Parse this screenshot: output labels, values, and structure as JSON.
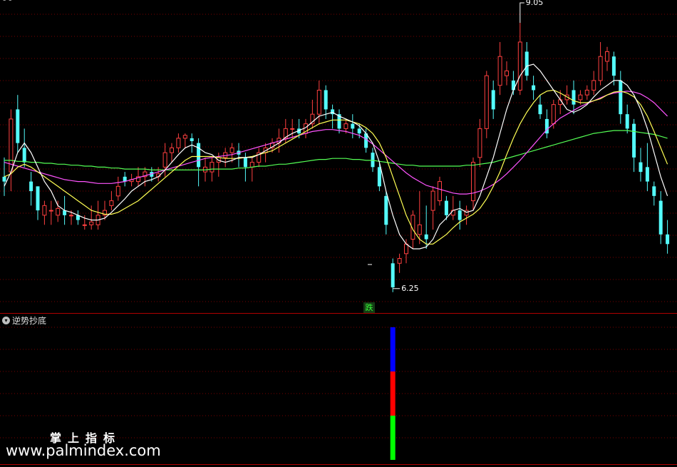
{
  "panels": {
    "indicator_title": "逆势抄底",
    "indicator_icon": "chevron-down-icon",
    "signal_label": "跌",
    "max_label": "9.05",
    "min_label": "6.25",
    "top_title": "- -"
  },
  "watermark": {
    "cn": "掌上指标",
    "url": "www.palmindex.com"
  },
  "colors": {
    "background": "#000000",
    "up_candle": "#ff4040",
    "down_candle": "#54fcfc",
    "ma_fast": "#ffffff",
    "ma_mid": "#ffff54",
    "ma_slow": "#ff54ff",
    "ma_long": "#54ff54",
    "grid": "#7a0000",
    "divider": "#b00000",
    "signal_blue": "#0000ff",
    "signal_red": "#ff0000",
    "signal_green": "#00ff00"
  },
  "chart_data": [
    {
      "type": "candlestick",
      "ylim": [
        6.1,
        9.25
      ],
      "grid": true,
      "series_order": [
        "open",
        "close",
        "high",
        "low"
      ],
      "candles": [
        [
          7.45,
          7.4,
          7.65,
          7.25
        ],
        [
          7.5,
          8.05,
          8.15,
          7.3
        ],
        [
          8.15,
          7.8,
          8.3,
          7.7
        ],
        [
          7.75,
          7.6,
          7.95,
          7.55
        ],
        [
          7.4,
          7.3,
          7.5,
          7.15
        ],
        [
          7.35,
          7.1,
          7.35,
          7.0
        ],
        [
          7.05,
          7.15,
          7.2,
          6.95
        ],
        [
          7.1,
          7.1,
          7.2,
          6.95
        ],
        [
          7.05,
          7.12,
          7.2,
          6.98
        ],
        [
          7.1,
          7.05,
          7.25,
          6.95
        ],
        [
          7.05,
          7.05,
          7.1,
          6.95
        ],
        [
          7.05,
          7.0,
          7.1,
          6.95
        ],
        [
          6.95,
          6.95,
          7.05,
          6.9
        ],
        [
          6.95,
          6.98,
          7.15,
          6.9
        ],
        [
          6.95,
          7.05,
          7.2,
          6.9
        ],
        [
          7.05,
          7.1,
          7.2,
          7.0
        ],
        [
          7.15,
          7.2,
          7.3,
          7.1
        ],
        [
          7.25,
          7.35,
          7.45,
          7.2
        ],
        [
          7.45,
          7.4,
          7.5,
          7.35
        ],
        [
          7.4,
          7.42,
          7.48,
          7.35
        ],
        [
          7.4,
          7.45,
          7.55,
          7.35
        ],
        [
          7.45,
          7.5,
          7.55,
          7.35
        ],
        [
          7.5,
          7.45,
          7.55,
          7.4
        ],
        [
          7.45,
          7.48,
          7.55,
          7.4
        ],
        [
          7.55,
          7.7,
          7.8,
          7.45
        ],
        [
          7.7,
          7.75,
          7.8,
          7.6
        ],
        [
          7.75,
          7.85,
          7.9,
          7.7
        ],
        [
          7.85,
          7.88,
          7.9,
          7.75
        ],
        [
          7.85,
          7.82,
          7.9,
          7.7
        ],
        [
          7.8,
          7.55,
          7.85,
          7.35
        ],
        [
          7.5,
          7.55,
          7.65,
          7.4
        ],
        [
          7.5,
          7.6,
          7.65,
          7.4
        ],
        [
          7.6,
          7.65,
          7.7,
          7.45
        ],
        [
          7.65,
          7.7,
          7.75,
          7.55
        ],
        [
          7.7,
          7.75,
          7.8,
          7.6
        ],
        [
          7.72,
          7.68,
          7.8,
          7.55
        ],
        [
          7.65,
          7.55,
          7.7,
          7.4
        ],
        [
          7.55,
          7.6,
          7.65,
          7.4
        ],
        [
          7.6,
          7.7,
          7.75,
          7.55
        ],
        [
          7.7,
          7.75,
          7.8,
          7.6
        ],
        [
          7.75,
          7.8,
          7.85,
          7.7
        ],
        [
          7.8,
          7.85,
          7.95,
          7.7
        ],
        [
          7.85,
          7.95,
          8.05,
          7.8
        ],
        [
          7.95,
          7.95,
          8.05,
          7.85
        ],
        [
          7.95,
          7.9,
          8.05,
          7.85
        ],
        [
          7.9,
          8.0,
          8.05,
          7.85
        ],
        [
          8.0,
          8.1,
          8.25,
          7.95
        ],
        [
          8.1,
          8.35,
          8.45,
          8.0
        ],
        [
          8.35,
          8.15,
          8.4,
          8.05
        ],
        [
          8.15,
          8.1,
          8.2,
          7.95
        ],
        [
          8.1,
          7.95,
          8.15,
          7.9
        ],
        [
          7.95,
          8.0,
          8.05,
          7.9
        ],
        [
          8.0,
          7.95,
          8.1,
          7.85
        ],
        [
          7.95,
          7.9,
          8.0,
          7.85
        ],
        [
          7.9,
          7.75,
          7.95,
          7.7
        ],
        [
          7.7,
          7.55,
          7.75,
          7.5
        ],
        [
          7.55,
          7.35,
          7.6,
          7.3
        ],
        [
          7.25,
          6.95,
          7.3,
          6.85
        ],
        [
          6.55,
          6.3,
          6.6,
          6.25
        ],
        [
          6.55,
          6.6,
          6.65,
          6.45
        ],
        [
          6.65,
          6.75,
          6.8,
          6.55
        ],
        [
          6.8,
          7.05,
          7.1,
          6.7
        ],
        [
          6.85,
          6.95,
          7.3,
          6.75
        ],
        [
          6.85,
          6.8,
          7.15,
          6.7
        ],
        [
          7.1,
          7.3,
          7.35,
          6.9
        ],
        [
          7.2,
          7.4,
          7.45,
          7.15
        ],
        [
          7.2,
          7.05,
          7.25,
          7.0
        ],
        [
          7.05,
          7.1,
          7.25,
          7.0
        ],
        [
          7.1,
          7.0,
          7.2,
          6.9
        ],
        [
          7.05,
          7.1,
          7.15,
          6.95
        ],
        [
          7.2,
          7.6,
          7.65,
          7.1
        ],
        [
          7.65,
          7.95,
          8.05,
          7.55
        ],
        [
          7.95,
          8.5,
          8.55,
          7.85
        ],
        [
          8.35,
          8.15,
          8.45,
          8.05
        ],
        [
          8.4,
          8.7,
          8.85,
          8.3
        ],
        [
          8.5,
          8.55,
          8.65,
          8.4
        ],
        [
          8.45,
          8.35,
          8.55,
          8.3
        ],
        [
          8.35,
          8.85,
          9.05,
          8.3
        ],
        [
          8.75,
          8.5,
          8.85,
          8.45
        ],
        [
          8.4,
          8.35,
          8.5,
          8.25
        ],
        [
          8.2,
          8.1,
          8.3,
          8.05
        ],
        [
          8.05,
          7.9,
          8.15,
          7.85
        ],
        [
          8.0,
          8.2,
          8.25,
          7.95
        ],
        [
          8.2,
          8.25,
          8.35,
          8.1
        ],
        [
          8.25,
          8.3,
          8.4,
          8.2
        ],
        [
          8.35,
          8.2,
          8.45,
          8.1
        ],
        [
          8.25,
          8.3,
          8.35,
          8.2
        ],
        [
          8.3,
          8.35,
          8.4,
          8.25
        ],
        [
          8.35,
          8.45,
          8.55,
          8.3
        ],
        [
          8.45,
          8.7,
          8.85,
          8.4
        ],
        [
          8.65,
          8.75,
          8.8,
          8.55
        ],
        [
          8.7,
          8.5,
          8.75,
          8.4
        ],
        [
          8.45,
          8.1,
          8.55,
          8.0
        ],
        [
          8.1,
          7.95,
          8.2,
          7.9
        ],
        [
          8.0,
          7.65,
          8.05,
          7.5
        ],
        [
          7.6,
          7.5,
          7.75,
          7.4
        ],
        [
          7.55,
          7.4,
          7.8,
          7.3
        ],
        [
          7.35,
          7.25,
          7.4,
          7.15
        ],
        [
          7.2,
          6.85,
          7.3,
          6.75
        ],
        [
          6.85,
          6.75,
          7.0,
          6.65
        ]
      ],
      "ma5": [
        7.35,
        7.5,
        7.7,
        7.8,
        7.7,
        7.55,
        7.4,
        7.3,
        7.15,
        7.1,
        7.08,
        7.05,
        7.02,
        7.0,
        7.0,
        7.02,
        7.08,
        7.15,
        7.22,
        7.3,
        7.35,
        7.4,
        7.42,
        7.45,
        7.52,
        7.6,
        7.68,
        7.75,
        7.78,
        7.75,
        7.7,
        7.68,
        7.62,
        7.6,
        7.62,
        7.65,
        7.65,
        7.65,
        7.68,
        7.72,
        7.76,
        7.8,
        7.86,
        7.9,
        7.93,
        7.96,
        8.02,
        8.08,
        8.1,
        8.12,
        8.08,
        8.05,
        8.02,
        7.98,
        7.9,
        7.8,
        7.6,
        7.3,
        7.05,
        6.85,
        6.75,
        6.7,
        6.7,
        6.72,
        6.8,
        6.95,
        7.02,
        7.1,
        7.12,
        7.08,
        7.1,
        7.25,
        7.45,
        7.65,
        7.9,
        8.15,
        8.35,
        8.5,
        8.6,
        8.62,
        8.55,
        8.45,
        8.35,
        8.25,
        8.15,
        8.12,
        8.15,
        8.2,
        8.28,
        8.35,
        8.4,
        8.45,
        8.45,
        8.4,
        8.3,
        8.15,
        7.95,
        7.7,
        7.45,
        7.25
      ],
      "ma10": [
        7.45,
        7.48,
        7.55,
        7.58,
        7.55,
        7.5,
        7.45,
        7.4,
        7.35,
        7.3,
        7.25,
        7.2,
        7.15,
        7.1,
        7.08,
        7.06,
        7.06,
        7.08,
        7.12,
        7.16,
        7.2,
        7.26,
        7.32,
        7.38,
        7.44,
        7.5,
        7.56,
        7.62,
        7.66,
        7.66,
        7.66,
        7.66,
        7.65,
        7.64,
        7.64,
        7.64,
        7.65,
        7.66,
        7.68,
        7.7,
        7.72,
        7.76,
        7.8,
        7.84,
        7.88,
        7.92,
        7.96,
        8.0,
        8.02,
        8.04,
        8.04,
        8.04,
        8.02,
        8.0,
        7.96,
        7.9,
        7.8,
        7.65,
        7.45,
        7.25,
        7.05,
        6.9,
        6.8,
        6.75,
        6.75,
        6.8,
        6.85,
        6.92,
        6.98,
        7.02,
        7.06,
        7.12,
        7.22,
        7.35,
        7.5,
        7.68,
        7.85,
        8.0,
        8.12,
        8.22,
        8.3,
        8.34,
        8.35,
        8.32,
        8.28,
        8.24,
        8.22,
        8.22,
        8.24,
        8.26,
        8.3,
        8.33,
        8.34,
        8.32,
        8.28,
        8.2,
        8.08,
        7.92,
        7.75,
        7.58
      ],
      "ma20": [
        7.6,
        7.58,
        7.56,
        7.54,
        7.52,
        7.5,
        7.48,
        7.46,
        7.44,
        7.42,
        7.41,
        7.4,
        7.4,
        7.39,
        7.38,
        7.38,
        7.38,
        7.39,
        7.4,
        7.42,
        7.44,
        7.46,
        7.48,
        7.5,
        7.52,
        7.54,
        7.56,
        7.58,
        7.6,
        7.62,
        7.64,
        7.65,
        7.66,
        7.67,
        7.68,
        7.7,
        7.72,
        7.74,
        7.76,
        7.78,
        7.8,
        7.82,
        7.84,
        7.86,
        7.88,
        7.9,
        7.92,
        7.93,
        7.94,
        7.94,
        7.93,
        7.92,
        7.9,
        7.88,
        7.84,
        7.79,
        7.73,
        7.67,
        7.61,
        7.55,
        7.49,
        7.44,
        7.4,
        7.36,
        7.34,
        7.32,
        7.3,
        7.28,
        7.27,
        7.27,
        7.28,
        7.3,
        7.33,
        7.37,
        7.42,
        7.48,
        7.55,
        7.62,
        7.7,
        7.78,
        7.86,
        7.94,
        8.0,
        8.06,
        8.1,
        8.14,
        8.18,
        8.21,
        8.24,
        8.27,
        8.3,
        8.32,
        8.33,
        8.34,
        8.33,
        8.31,
        8.27,
        8.22,
        8.15,
        8.08
      ],
      "ma60": [
        7.62,
        7.62,
        7.61,
        7.61,
        7.6,
        7.6,
        7.59,
        7.59,
        7.58,
        7.58,
        7.57,
        7.57,
        7.56,
        7.56,
        7.55,
        7.55,
        7.54,
        7.54,
        7.53,
        7.53,
        7.53,
        7.53,
        7.52,
        7.52,
        7.52,
        7.52,
        7.52,
        7.52,
        7.52,
        7.52,
        7.52,
        7.53,
        7.53,
        7.53,
        7.53,
        7.54,
        7.54,
        7.55,
        7.56,
        7.56,
        7.57,
        7.58,
        7.58,
        7.59,
        7.6,
        7.61,
        7.62,
        7.63,
        7.63,
        7.64,
        7.64,
        7.64,
        7.63,
        7.63,
        7.62,
        7.62,
        7.61,
        7.6,
        7.59,
        7.58,
        7.57,
        7.57,
        7.56,
        7.56,
        7.56,
        7.56,
        7.56,
        7.56,
        7.56,
        7.57,
        7.57,
        7.58,
        7.59,
        7.6,
        7.62,
        7.64,
        7.66,
        7.68,
        7.7,
        7.72,
        7.74,
        7.76,
        7.78,
        7.8,
        7.82,
        7.84,
        7.86,
        7.88,
        7.9,
        7.91,
        7.92,
        7.93,
        7.93,
        7.93,
        7.92,
        7.91,
        7.9,
        7.89,
        7.87,
        7.85
      ]
    },
    {
      "type": "bar",
      "panel": "indicator",
      "index": 58,
      "segments": [
        {
          "color": "#0000ff",
          "value": 1
        },
        {
          "color": "#ff0000",
          "value": 1
        },
        {
          "color": "#00ff00",
          "value": 1
        }
      ]
    }
  ]
}
